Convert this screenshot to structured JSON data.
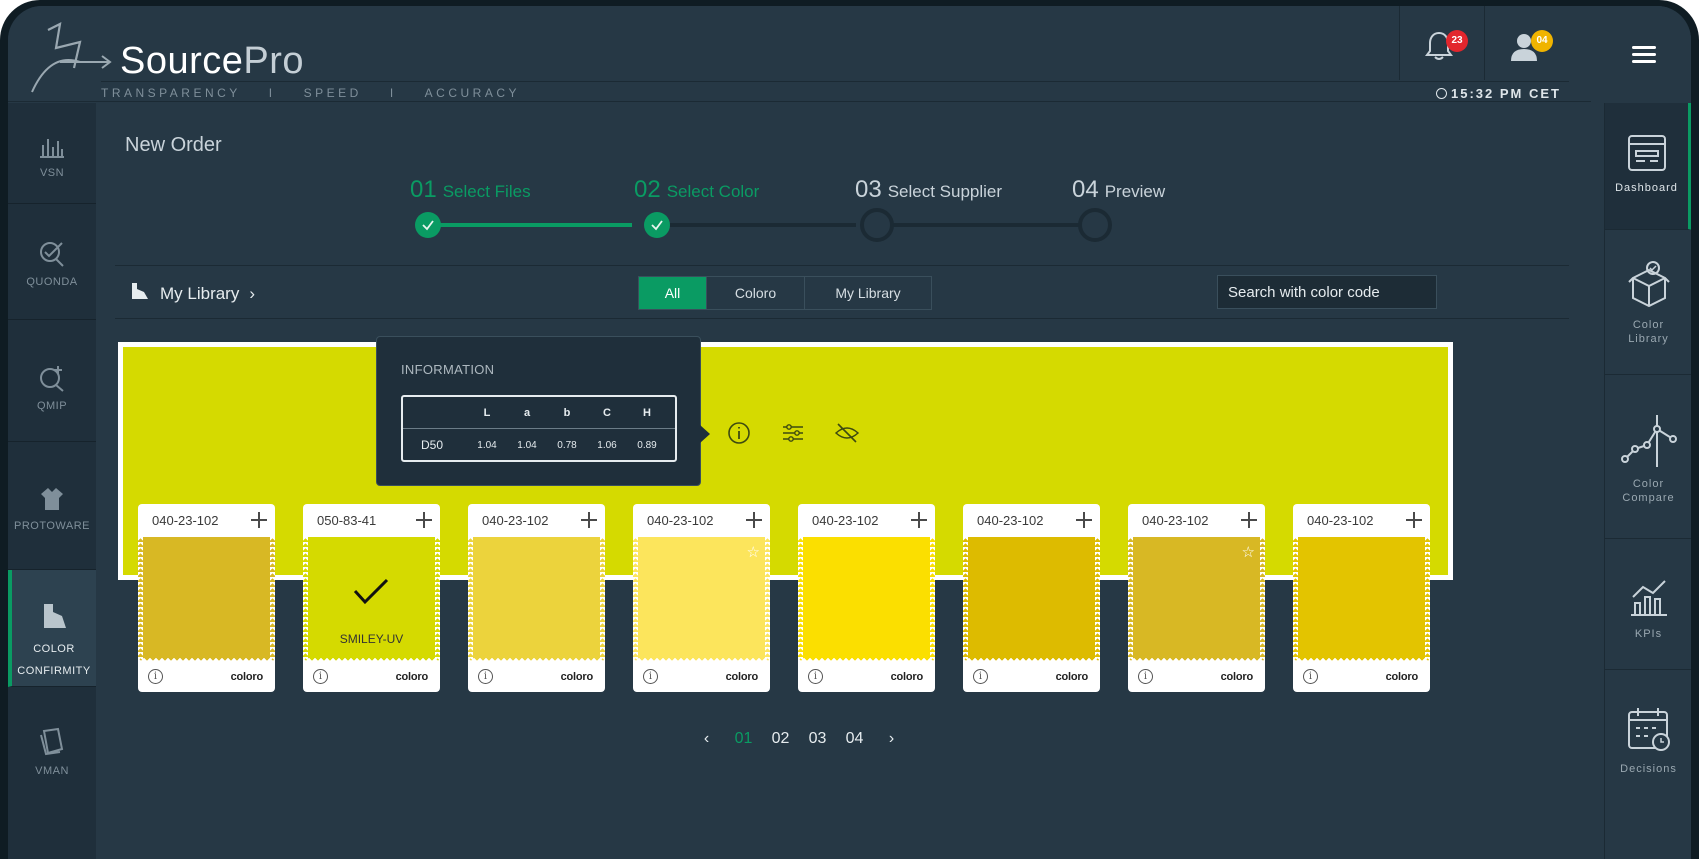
{
  "app": {
    "brand_main": "Source",
    "brand_sub": "Pro",
    "tagline": [
      "TRANSPARENCY",
      "I",
      "SPEED",
      "I",
      "ACCURACY"
    ],
    "clock": "15:32 PM CET",
    "notifications_count": "23",
    "profile_count": "04"
  },
  "left_nav": [
    {
      "label": "VSN",
      "icon": "bar-chart-icon"
    },
    {
      "label": "QUONDA",
      "icon": "search-check-icon"
    },
    {
      "label": "QMIP",
      "icon": "search-plus-icon"
    },
    {
      "label": "PROTOWARE",
      "icon": "shirt-icon"
    },
    {
      "label": "COLOR",
      "label2": "CONFIRMITY",
      "icon": "color-swatch-icon",
      "active": true
    },
    {
      "label": "VMAN",
      "icon": "document-stack-icon"
    }
  ],
  "right_nav": [
    {
      "label": "Dashboard",
      "icon": "dashboard-icon",
      "active": true
    },
    {
      "label": "Color",
      "label2": "Library",
      "icon": "box-icon"
    },
    {
      "label": "Color",
      "label2": "Compare",
      "icon": "graph-nodes-icon"
    },
    {
      "label": "KPIs",
      "icon": "kpi-chart-icon"
    },
    {
      "label": "Decisions",
      "icon": "calendar-clock-icon"
    }
  ],
  "page": {
    "title": "New Order",
    "steps": [
      {
        "num": "01",
        "label": "Select Files",
        "state": "done"
      },
      {
        "num": "02",
        "label": "Select Color",
        "state": "done"
      },
      {
        "num": "03",
        "label": "Select Supplier",
        "state": "todo"
      },
      {
        "num": "04",
        "label": "Preview",
        "state": "todo"
      }
    ],
    "library_label": "My Library",
    "filters": [
      "All",
      "Coloro",
      "My Library"
    ],
    "active_filter": "All",
    "search_placeholder": "Search with color code"
  },
  "preview": {
    "color": "#d5da00",
    "info": {
      "title": "INFORMATION",
      "headers": [
        "L",
        "a",
        "b",
        "C",
        "H"
      ],
      "row_label": "D50",
      "values": [
        "1.04",
        "1.04",
        "0.78",
        "1.06",
        "0.89"
      ]
    }
  },
  "swatches": [
    {
      "code": "040-23-102",
      "color": "#d8b824",
      "brand": "coloro",
      "star": false
    },
    {
      "code": "050-83-41",
      "color": "#d5da00",
      "brand": "coloro",
      "selected": true,
      "name": "SMILEY-UV"
    },
    {
      "code": "040-23-102",
      "color": "#ecd33c",
      "brand": "coloro",
      "star": false
    },
    {
      "code": "040-23-102",
      "color": "#fce55c",
      "brand": "coloro",
      "star": true
    },
    {
      "code": "040-23-102",
      "color": "#fbdf00",
      "brand": "coloro",
      "star": false
    },
    {
      "code": "040-23-102",
      "color": "#ddbb00",
      "brand": "coloro",
      "star": false
    },
    {
      "code": "040-23-102",
      "color": "#d8b824",
      "brand": "coloro",
      "star": true
    },
    {
      "code": "040-23-102",
      "color": "#e3c400",
      "brand": "coloro",
      "star": false
    }
  ],
  "pager": {
    "pages": [
      "01",
      "02",
      "03",
      "04"
    ],
    "current": "01"
  },
  "colors": {
    "accent": "#0a9b63",
    "background": "#263845",
    "badge_red": "#e3262d",
    "badge_yellow": "#f0b400"
  }
}
